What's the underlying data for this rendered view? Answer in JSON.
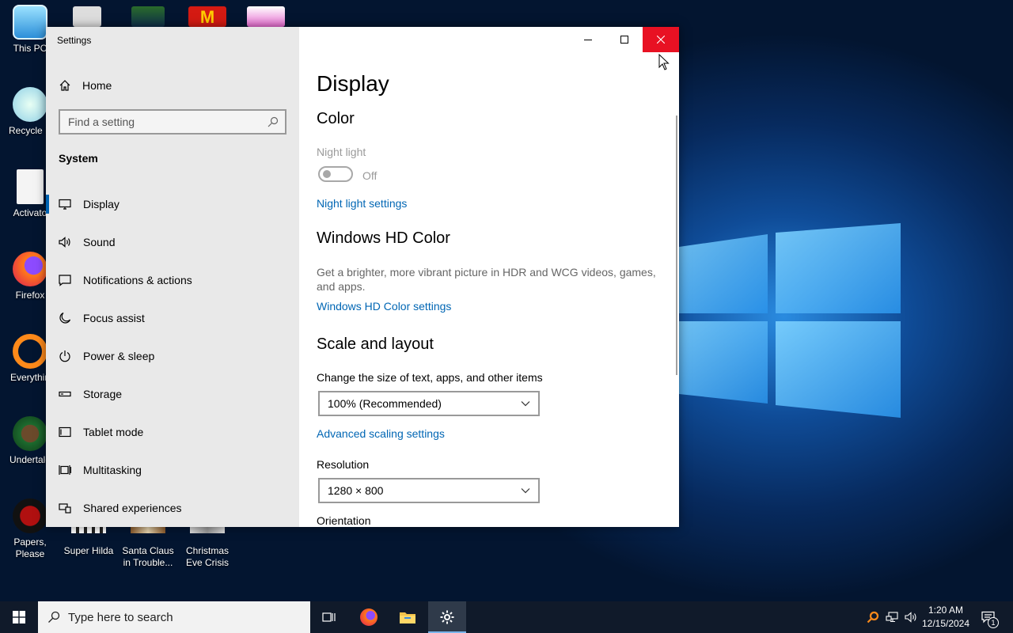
{
  "desktop": {
    "icons": [
      {
        "label": "This PC",
        "icon": "this-pc-icon"
      },
      {
        "label": "Recycle B",
        "icon": "recycle-bin-icon"
      },
      {
        "label": "Activato",
        "icon": "activator-file-icon"
      },
      {
        "label": "Firefox",
        "icon": "firefox-icon"
      },
      {
        "label": "Everythin",
        "icon": "everything-search-icon"
      },
      {
        "label": "Undertale",
        "icon": "undertale-icon"
      },
      {
        "label": "Papers, Please",
        "icon": "papers-please-icon"
      },
      {
        "label": "Super Hilda",
        "icon": "super-hilda-icon"
      },
      {
        "label": "Santa Claus in Trouble...",
        "icon": "santa-claus-icon"
      },
      {
        "label": "Christmas Eve Crisis",
        "icon": "christmas-eve-crisis-icon"
      }
    ]
  },
  "window": {
    "title": "Settings",
    "sidebar": {
      "home_label": "Home",
      "search_placeholder": "Find a setting",
      "group_label": "System",
      "items": [
        {
          "label": "Display",
          "icon": "display-icon",
          "active": true
        },
        {
          "label": "Sound",
          "icon": "sound-icon"
        },
        {
          "label": "Notifications & actions",
          "icon": "notifications-icon"
        },
        {
          "label": "Focus assist",
          "icon": "moon-icon"
        },
        {
          "label": "Power & sleep",
          "icon": "power-icon"
        },
        {
          "label": "Storage",
          "icon": "storage-icon"
        },
        {
          "label": "Tablet mode",
          "icon": "tablet-icon"
        },
        {
          "label": "Multitasking",
          "icon": "multitasking-icon"
        },
        {
          "label": "Shared experiences",
          "icon": "shared-experiences-icon"
        }
      ]
    },
    "content": {
      "page_title": "Display",
      "color_heading": "Color",
      "night_light_label": "Night light",
      "night_light_state": "Off",
      "night_light_link": "Night light settings",
      "hd_color_heading": "Windows HD Color",
      "hd_color_desc": "Get a brighter, more vibrant picture in HDR and WCG videos, games, and apps.",
      "hd_color_link": "Windows HD Color settings",
      "scale_heading": "Scale and layout",
      "scale_label": "Change the size of text, apps, and other items",
      "scale_value": "100% (Recommended)",
      "advanced_scaling_link": "Advanced scaling settings",
      "resolution_label": "Resolution",
      "resolution_value": "1280 × 800",
      "orientation_label": "Orientation"
    }
  },
  "taskbar": {
    "search_placeholder": "Type here to search",
    "time": "1:20 AM",
    "date": "12/15/2024",
    "notification_count": "1"
  },
  "colors": {
    "accent": "#0063b1",
    "link": "#0066b4",
    "close_hover": "#e81123"
  }
}
